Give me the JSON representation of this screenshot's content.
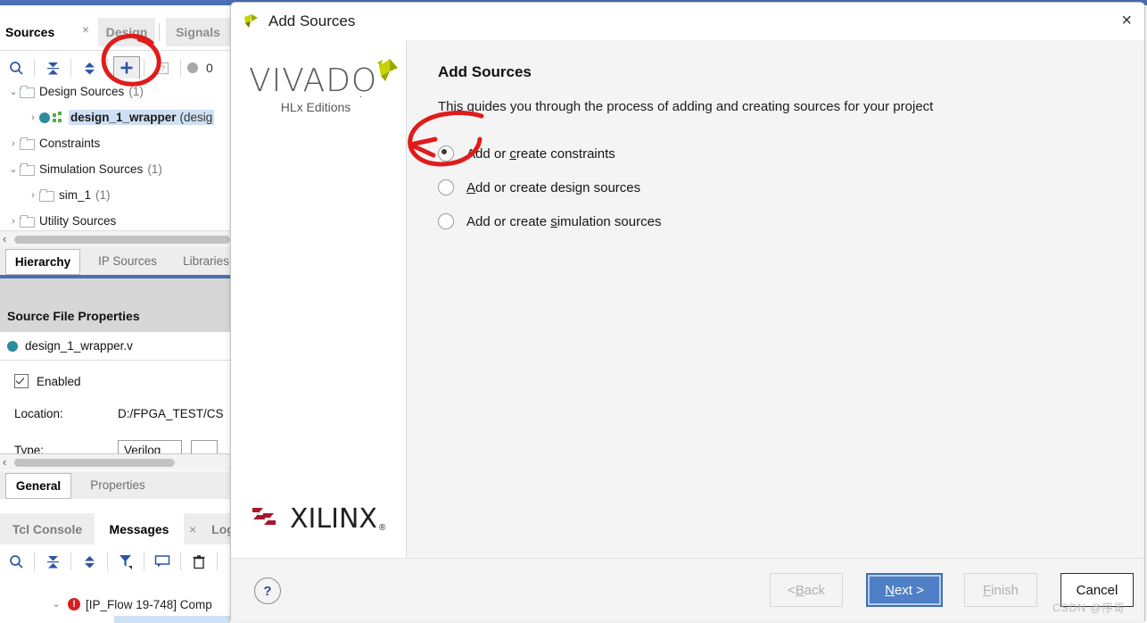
{
  "ide": {
    "sources_panel": {
      "tabs": [
        {
          "label": "Sources",
          "active": true
        },
        {
          "label": "Design",
          "active": false
        },
        {
          "label": "Signals",
          "active": false
        }
      ],
      "close_glyph": "×",
      "toolbar": {
        "search_icon": "search-icon",
        "collapse_icon": "collapse-all-icon",
        "expand_icon": "expand-all-icon",
        "add_icon": "+",
        "help_icon": "?",
        "status_count": "0"
      },
      "tree": [
        {
          "label": "Design Sources",
          "count": "(1)",
          "expander": "⌄",
          "indent": 0,
          "icon": "folder-icon"
        },
        {
          "label": "design_1_wrapper",
          "suffix": "(desig",
          "expander": "›",
          "indent": 1,
          "icon": "module-icon",
          "selected": true
        },
        {
          "label": "Constraints",
          "count": "",
          "expander": "›",
          "indent": 0,
          "icon": "folder-icon"
        },
        {
          "label": "Simulation Sources",
          "count": "(1)",
          "expander": "⌄",
          "indent": 0,
          "icon": "folder-icon"
        },
        {
          "label": "sim_1",
          "count": "(1)",
          "expander": "›",
          "indent": 1,
          "icon": "folder-icon"
        },
        {
          "label": "Utility Sources",
          "count": "",
          "expander": "›",
          "indent": 0,
          "icon": "folder-icon"
        }
      ],
      "bottom_tabs": [
        {
          "label": "Hierarchy",
          "active": true
        },
        {
          "label": "IP Sources",
          "active": false
        },
        {
          "label": "Libraries",
          "active": false
        }
      ]
    },
    "source_file_properties": {
      "title": "Source File Properties",
      "file_name": "design_1_wrapper.v",
      "enabled_label": "Enabled",
      "enabled_checked": true,
      "location_label": "Location:",
      "location_value": "D:/FPGA_TEST/CS",
      "type_label": "Type:",
      "type_value": "Verilog",
      "tabs": [
        {
          "label": "General",
          "active": true
        },
        {
          "label": "Properties",
          "active": false
        }
      ]
    },
    "console": {
      "tabs": [
        {
          "label": "Tcl Console",
          "active": false
        },
        {
          "label": "Messages",
          "active": true
        },
        {
          "label": "Log",
          "active": false
        }
      ],
      "close_glyph": "×",
      "toolbar_icons": [
        "search-icon",
        "collapse-all-icon",
        "expand-all-icon",
        "filter-icon",
        "comment-icon",
        "trash-icon"
      ],
      "message": {
        "expander": "⌄",
        "severity": "error",
        "severity_glyph": "!",
        "text": "[IP_Flow 19-748] Comp"
      }
    }
  },
  "dialog": {
    "title": "Add Sources",
    "close_glyph": "×",
    "branding": {
      "product": "VIVADO",
      "edition": "HLx Editions",
      "vendor": "XILINX"
    },
    "heading": "Add Sources",
    "description": "This guides you through the process of adding and creating sources for your project",
    "options": [
      {
        "id": "constraints",
        "label_pre": "Add or ",
        "mnemonic": "c",
        "label_post": "reate constraints",
        "selected": true
      },
      {
        "id": "design",
        "label_pre": "",
        "mnemonic": "A",
        "label_post": "dd or create design sources",
        "selected": false
      },
      {
        "id": "simulation",
        "label_pre": "Add or create ",
        "mnemonic": "s",
        "label_post": "imulation sources",
        "selected": false
      }
    ],
    "footer": {
      "help_label": "?",
      "back_label_pre": "< ",
      "back_mnemonic": "B",
      "back_label_post": "ack",
      "next_mnemonic": "N",
      "next_label_post": "ext >",
      "finish_mnemonic": "F",
      "finish_label_post": "inish",
      "cancel_label": "Cancel",
      "watermark": "CSDN @序哥"
    }
  },
  "colors": {
    "accent_blue": "#4a6fb5",
    "primary_button": "#4f7fc4",
    "selection": "#cfe0f5",
    "error_red": "#d52020",
    "annotation_red": "#e01b1b",
    "xilinx_red": "#a4182c",
    "vivado_green": "#c8d400"
  }
}
